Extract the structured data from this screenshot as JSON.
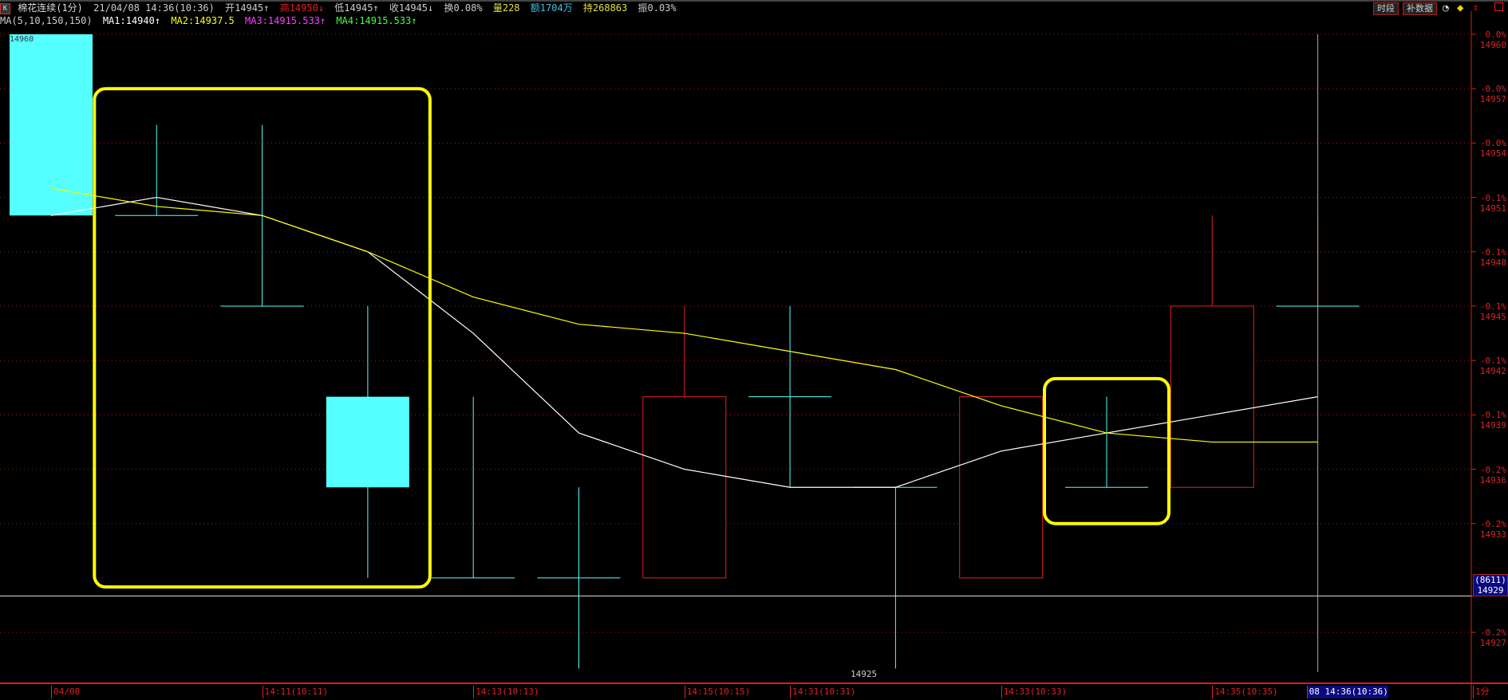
{
  "header": {
    "k_label": "K",
    "title": "棉花连续(1分)",
    "datetime": "21/04/08 14:36(10:36)",
    "open": "开14945↑",
    "high": "高14950↓",
    "low": "低14945↑",
    "close": "收14945↓",
    "turnover": "换0.08%",
    "volume": "量228",
    "amount": "额1704万",
    "position": "持268863",
    "amplitude": "振0.03%",
    "ma_params": "MA(5,10,150,150)",
    "ma1": "MA1:14940↑",
    "ma2": "MA2:14937.5",
    "ma3": "MA3:14915.533↑",
    "ma4": "MA4:14915.533↑"
  },
  "toolbar": {
    "period_button": "时段",
    "fill_data_button": "补数据"
  },
  "colors": {
    "up": "#e02020",
    "down": "#55ffff",
    "ma1": "#ffffff",
    "ma2": "#ffff00",
    "ma3": "#ff40ff",
    "ma4": "#40ff40",
    "axis": "#d22020",
    "highlight": "#ffff00"
  },
  "cursor": {
    "volume_label": "(8611)",
    "price_label": "14929",
    "price": 14929
  },
  "low_annotation": "14925",
  "top_annotation": "14960",
  "chart_data": {
    "type": "candlestick",
    "title": "棉花连续(1分)",
    "ylim": [
      14927,
      14960
    ],
    "y_ticks": [
      {
        "price": "14960",
        "pct": "0.0%"
      },
      {
        "price": "14957",
        "pct": "-0.0%"
      },
      {
        "price": "14954",
        "pct": "-0.0%"
      },
      {
        "price": "14951",
        "pct": "-0.1%"
      },
      {
        "price": "14948",
        "pct": "-0.1%"
      },
      {
        "price": "14945",
        "pct": "-0.1%"
      },
      {
        "price": "14942",
        "pct": "-0.1%"
      },
      {
        "price": "14939",
        "pct": "-0.1%"
      },
      {
        "price": "14936",
        "pct": "-0.2%"
      },
      {
        "price": "14933",
        "pct": "-0.2%"
      },
      {
        "price": "14929",
        "pct": "-0.2%"
      },
      {
        "price": "14927",
        "pct": "-0.2%"
      }
    ],
    "x_labels": [
      "04/08",
      "14:11(10:11)",
      "14:13(10:13)",
      "14:15(10:15)",
      "14:31(10:31)",
      "14:33(10:33)",
      "14:35(10:35)",
      "08 14:36(10:36)"
    ],
    "x_label_index": [
      0,
      2,
      4,
      6,
      7,
      9,
      11,
      12
    ],
    "period_label": "1分",
    "candles": [
      {
        "o": 14960,
        "h": 14960,
        "l": 14950,
        "c": 14950
      },
      {
        "o": 14950,
        "h": 14955,
        "l": 14950,
        "c": 14950
      },
      {
        "o": 14945,
        "h": 14955,
        "l": 14945,
        "c": 14945
      },
      {
        "o": 14940,
        "h": 14945,
        "l": 14930,
        "c": 14935
      },
      {
        "o": 14930,
        "h": 14940,
        "l": 14930,
        "c": 14930
      },
      {
        "o": 14930,
        "h": 14935,
        "l": 14925,
        "c": 14930
      },
      {
        "o": 14930,
        "h": 14945,
        "l": 14930,
        "c": 14940
      },
      {
        "o": 14940,
        "h": 14945,
        "l": 14935,
        "c": 14940
      },
      {
        "o": 14935,
        "h": 14935,
        "l": 14925,
        "c": 14935
      },
      {
        "o": 14930,
        "h": 14940,
        "l": 14930,
        "c": 14940
      },
      {
        "o": 14935,
        "h": 14940,
        "l": 14935,
        "c": 14935
      },
      {
        "o": 14935,
        "h": 14950,
        "l": 14935,
        "c": 14945
      },
      {
        "o": 14945,
        "h": 14950,
        "l": 14945,
        "c": 14945
      }
    ],
    "series": [
      {
        "name": "MA1",
        "values": [
          14950,
          14951,
          14950,
          14948,
          14943.5,
          14938,
          14936,
          14935,
          14935,
          14937,
          14938,
          14939,
          14940
        ]
      },
      {
        "name": "MA2",
        "values": [
          14951.5,
          14950.5,
          14950,
          14948,
          14945.5,
          14944,
          14943.5,
          14942.5,
          14941.5,
          14939.5,
          14938,
          14937.5,
          14937.5
        ]
      }
    ],
    "highlight_boxes": [
      {
        "from_index": 1,
        "to_index": 3,
        "price_top": 14957,
        "price_bottom": 14929.5
      },
      {
        "from_index": 10,
        "to_index": 10,
        "price_top": 14941,
        "price_bottom": 14933
      }
    ]
  }
}
